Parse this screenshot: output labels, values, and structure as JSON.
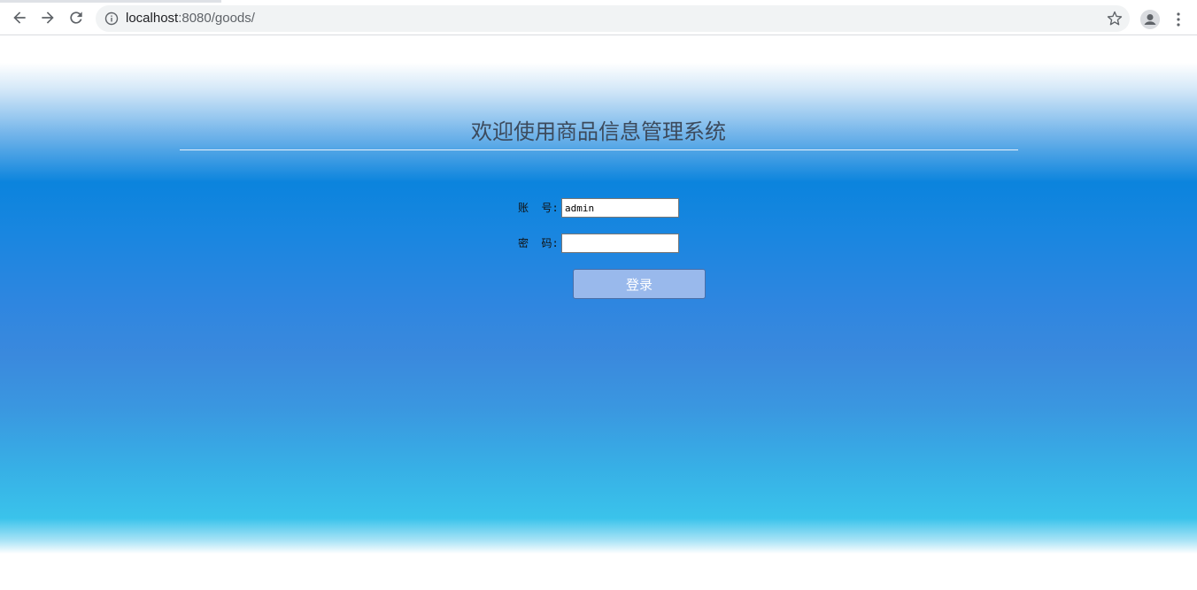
{
  "browser": {
    "url_host": "localhost",
    "url_path": ":8080/goods/",
    "icons": {
      "back": "arrow-left-icon",
      "forward": "arrow-right-icon",
      "reload": "reload-icon",
      "info": "info-icon",
      "bookmark": "star-icon",
      "profile": "person-icon",
      "menu": "kebab-menu-icon"
    }
  },
  "login": {
    "title": "欢迎使用商品信息管理系统",
    "account_label": "账  号:",
    "account_value": "admin",
    "password_label": "密  码:",
    "password_value": "",
    "submit_label": "登录"
  },
  "colors": {
    "button_bg": "#99b9ec",
    "gradient_mid": "#0b84dd",
    "gradient_low": "#3ac3eb"
  }
}
